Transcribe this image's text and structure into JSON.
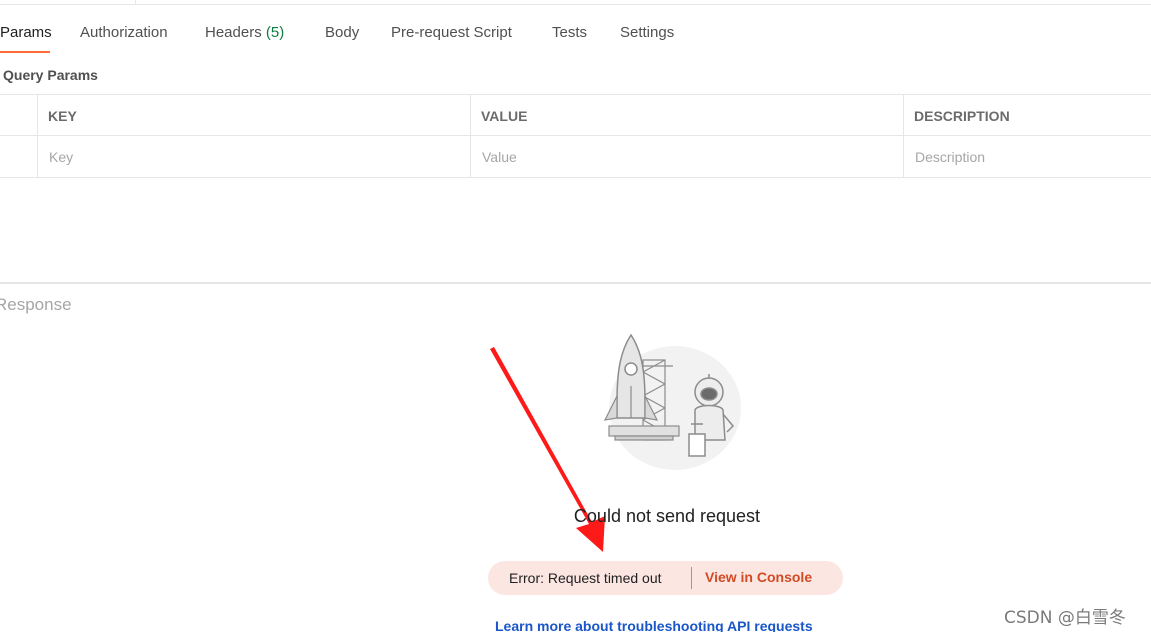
{
  "tabs": [
    {
      "label": "Params",
      "active": true
    },
    {
      "label": "Authorization"
    },
    {
      "label": "Headers",
      "count": "(5)"
    },
    {
      "label": "Body"
    },
    {
      "label": "Pre-request Script"
    },
    {
      "label": "Tests"
    },
    {
      "label": "Settings"
    }
  ],
  "query_params": {
    "title": "Query Params",
    "columns": {
      "key": "KEY",
      "value": "VALUE",
      "description": "DESCRIPTION"
    },
    "placeholders": {
      "key": "Key",
      "value": "Value",
      "description": "Description"
    }
  },
  "response": {
    "label": "Response",
    "error_title": "Could not send request",
    "error_message": "Error: Request timed out",
    "console_button": "View in Console",
    "learn_link": "Learn more about troubleshooting API requests"
  },
  "watermark": "CSDN @白雪冬",
  "colors": {
    "accent": "#ff6c37",
    "error_bg": "#fbe6e2",
    "console_link": "#d14b24",
    "learn_link": "#1a56c7",
    "annotation_arrow": "#ff1a1a"
  }
}
